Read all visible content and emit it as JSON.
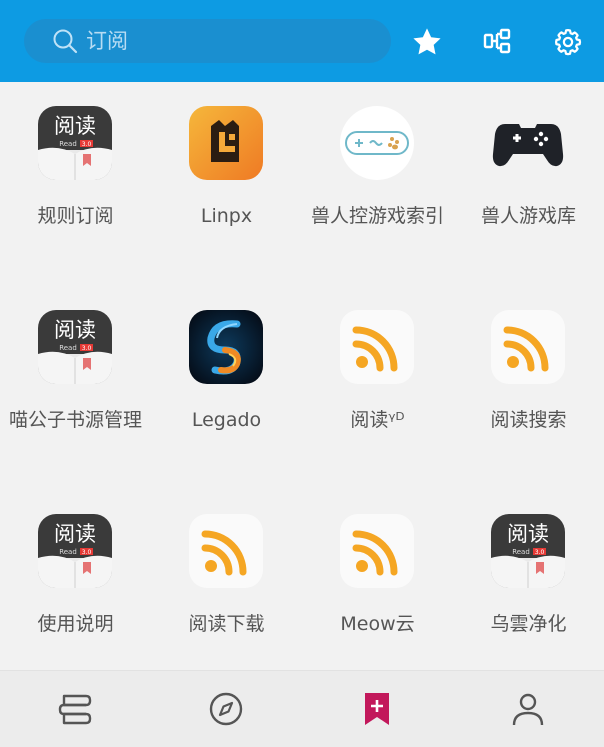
{
  "search": {
    "placeholder": "订阅"
  },
  "toolbar": {
    "favorites_icon": "star-icon",
    "group_icon": "group-icon",
    "settings_icon": "gear-icon"
  },
  "colors": {
    "toolbar": "#0d9be3",
    "accent": "#c2185b",
    "background": "#f2f2f2"
  },
  "sources": [
    {
      "label": "规则订阅",
      "icon": "read-app-icon"
    },
    {
      "label": "Linpx",
      "icon": "linpx-logo-icon"
    },
    {
      "label": "兽人控游戏索引",
      "icon": "gamepad-logo-icon"
    },
    {
      "label": "兽人游戏库",
      "icon": "gamepad-icon"
    },
    {
      "label": "喵公子书源管理",
      "icon": "read-app-icon"
    },
    {
      "label": "Legado",
      "icon": "legado-logo-icon"
    },
    {
      "label": "阅读ᵞᴰ",
      "icon": "rss-icon"
    },
    {
      "label": "阅读搜索",
      "icon": "rss-icon"
    },
    {
      "label": "使用说明",
      "icon": "read-app-icon"
    },
    {
      "label": "阅读下载",
      "icon": "rss-icon"
    },
    {
      "label": "Meow云",
      "icon": "rss-icon"
    },
    {
      "label": "乌雲净化",
      "icon": "read-app-icon"
    }
  ],
  "read_icon_text": {
    "title": "阅读",
    "sub": "Read",
    "badge": "3.0"
  },
  "bottom_nav": [
    {
      "name": "bookshelf",
      "icon": "bookshelf-icon"
    },
    {
      "name": "discover",
      "icon": "compass-icon"
    },
    {
      "name": "subscription",
      "icon": "bookmark-add-icon",
      "active": true
    },
    {
      "name": "mine",
      "icon": "person-icon"
    }
  ]
}
